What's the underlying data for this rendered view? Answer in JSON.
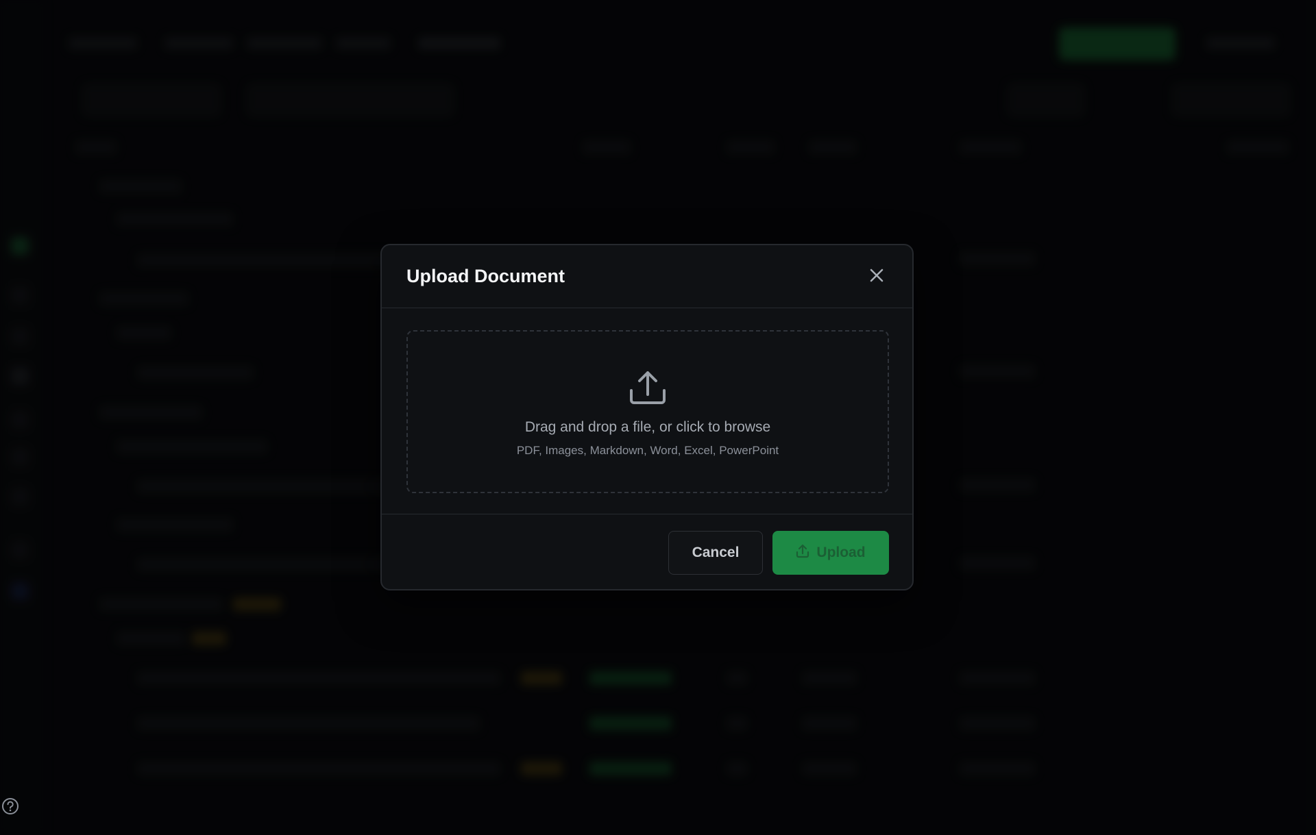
{
  "modal": {
    "title": "Upload Document",
    "dropzone": {
      "primary_text": "Drag and drop a file, or click to browse",
      "secondary_text": "PDF, Images, Markdown, Word, Excel, PowerPoint"
    },
    "cancel_label": "Cancel",
    "upload_label": "Upload",
    "upload_disabled": true
  },
  "colors": {
    "accent_green": "#1d8a45",
    "modal_bg": "#0f1114",
    "page_bg": "#08090b"
  },
  "icons": {
    "close": "close-icon",
    "upload": "upload-icon",
    "help": "help-icon"
  }
}
